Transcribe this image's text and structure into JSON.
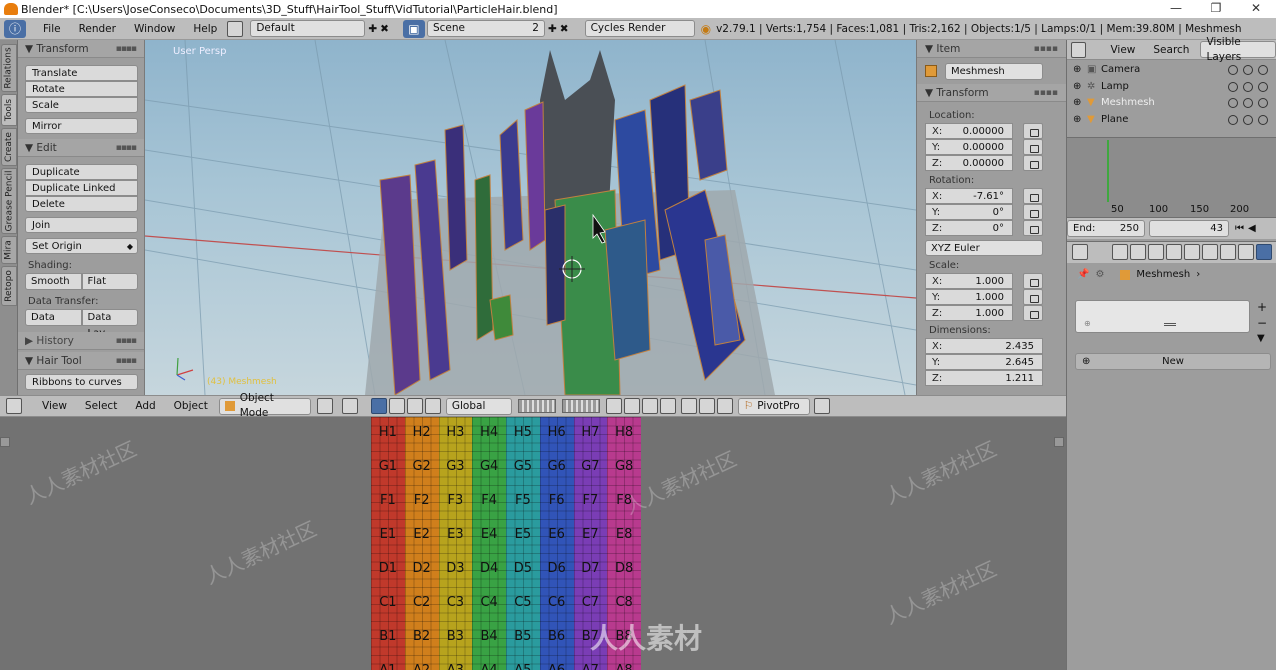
{
  "window": {
    "title": "Blender* [C:\\Users\\JoseConseco\\Documents\\3D_Stuff\\HairTool_Stuff\\VidTutorial\\ParticleHair.blend]",
    "minimize": "—",
    "maximize": "❐",
    "close": "✕"
  },
  "info_header": {
    "menus": [
      "File",
      "Render",
      "Window",
      "Help"
    ],
    "screen_layout": "Default",
    "scene": "Scene",
    "scene_users": "2",
    "render_engine": "Cycles Render",
    "stats": "v2.79.1 | Verts:1,754 | Faces:1,081 | Tris:2,162 | Objects:1/5 | Lamps:0/1 | Mem:39.80M | Meshmesh"
  },
  "side_tabs": [
    "Relations",
    "Tools",
    "Create",
    "Grease Pencil",
    "Mira",
    "Retopo"
  ],
  "toolshelf": {
    "transform": {
      "title": "Transform",
      "buttons": [
        "Translate",
        "Rotate",
        "Scale"
      ],
      "mirror": "Mirror"
    },
    "edit": {
      "title": "Edit",
      "buttons": [
        "Duplicate",
        "Duplicate Linked",
        "Delete"
      ],
      "join": "Join",
      "set_origin": "Set Origin",
      "shading_label": "Shading:",
      "smooth": "Smooth",
      "flat": "Flat",
      "data_transfer_label": "Data Transfer:",
      "data": "Data",
      "data_layout": "Data Lay..."
    },
    "history": "History",
    "hair_tool": "Hair Tool",
    "ribbons": "Ribbons to curves"
  },
  "viewport": {
    "view_label": "User Persp",
    "object_label": "(43) Meshmesh"
  },
  "n_panel": {
    "item_title": "Item",
    "object_name": "Meshmesh",
    "transform_title": "Transform",
    "location_label": "Location:",
    "location": [
      {
        "axis": "X:",
        "value": "0.00000"
      },
      {
        "axis": "Y:",
        "value": "0.00000"
      },
      {
        "axis": "Z:",
        "value": "0.00000"
      }
    ],
    "rotation_label": "Rotation:",
    "rotation": [
      {
        "axis": "X:",
        "value": "-7.61°"
      },
      {
        "axis": "Y:",
        "value": "0°"
      },
      {
        "axis": "Z:",
        "value": "0°"
      }
    ],
    "rotation_mode": "XYZ Euler",
    "scale_label": "Scale:",
    "scale": [
      {
        "axis": "X:",
        "value": "1.000"
      },
      {
        "axis": "Y:",
        "value": "1.000"
      },
      {
        "axis": "Z:",
        "value": "1.000"
      }
    ],
    "dimensions_label": "Dimensions:",
    "dimensions": [
      {
        "axis": "X:",
        "value": "2.435"
      },
      {
        "axis": "Y:",
        "value": "2.645"
      },
      {
        "axis": "Z:",
        "value": "1.211"
      }
    ]
  },
  "outliner": {
    "view": "View",
    "search": "Search",
    "filter": "Visible Layers",
    "items": [
      "Camera",
      "Lamp",
      "Meshmesh",
      "Plane"
    ]
  },
  "timeline": {
    "ticks": [
      "50",
      "100",
      "150",
      "200"
    ],
    "end_label": "End:",
    "end_value": "250",
    "current_frame": "43"
  },
  "properties": {
    "breadcrumb": "Meshmesh",
    "new_button": "New"
  },
  "view3d_header": {
    "menus": [
      "View",
      "Select",
      "Add",
      "Object"
    ],
    "mode": "Object Mode",
    "orientation": "Global",
    "pivot": "PivotPro"
  },
  "uv_grid": {
    "columns": [
      "1",
      "2",
      "3",
      "4",
      "5",
      "6",
      "7",
      "8"
    ],
    "rows": [
      "H",
      "G",
      "F",
      "E",
      "D",
      "C",
      "B",
      "A"
    ],
    "column_colors": [
      "#c0392b",
      "#d07f1c",
      "#b7a31d",
      "#39a244",
      "#2a9b9e",
      "#3154b8",
      "#7a3db5",
      "#b83a8e"
    ]
  },
  "watermark": "人人素材社区",
  "watermark_logo": "人人素材"
}
